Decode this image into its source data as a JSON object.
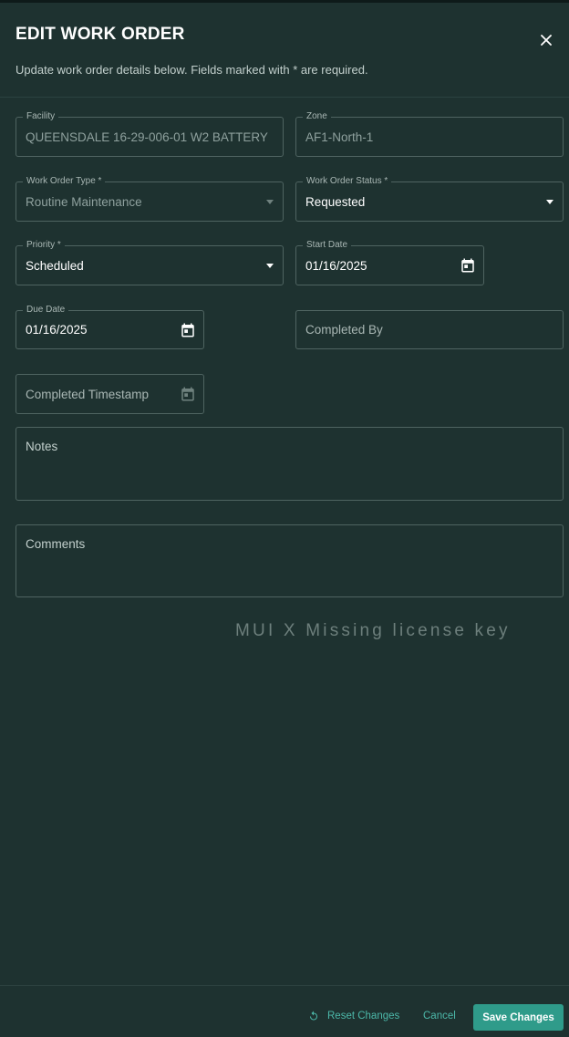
{
  "dialog": {
    "title": "EDIT WORK ORDER",
    "subtitle": "Update work order details below. Fields marked with * are required."
  },
  "fields": {
    "facility": {
      "label": "Facility",
      "value": "QUEENSDALE 16-29-006-01 W2 BATTERY"
    },
    "zone": {
      "label": "Zone",
      "value": "AF1-North-1"
    },
    "work_order_type": {
      "label": "Work Order Type *",
      "value": "Routine Maintenance"
    },
    "work_order_status": {
      "label": "Work Order Status *",
      "value": "Requested"
    },
    "priority": {
      "label": "Priority *",
      "value": "Scheduled"
    },
    "start_date": {
      "label": "Start Date",
      "value": "01/16/2025"
    },
    "due_date": {
      "label": "Due Date",
      "value": "01/16/2025"
    },
    "completed_by": {
      "placeholder": "Completed By"
    },
    "completed_timestamp": {
      "placeholder": "Completed Timestamp"
    },
    "notes": {
      "placeholder": "Notes"
    },
    "comments": {
      "placeholder": "Comments"
    }
  },
  "watermark": "MUI X Missing license key",
  "footer": {
    "reset_label": "Reset Changes",
    "cancel_label": "Cancel",
    "save_label": "Save Changes"
  },
  "colors": {
    "background": "#1e3230",
    "accent": "#2f9b8a",
    "accent_text": "#4cb8a9"
  },
  "icons": [
    "close-icon",
    "dropdown-arrow-icon",
    "calendar-icon",
    "reset-icon"
  ]
}
